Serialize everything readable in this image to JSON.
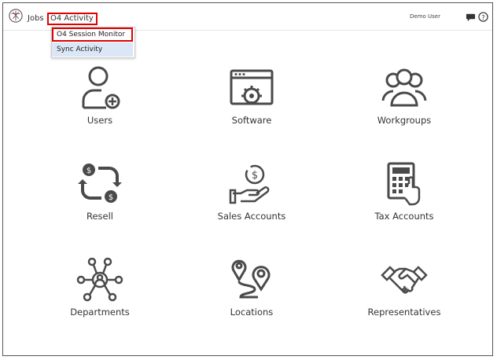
{
  "header": {
    "jobs_label": "Jobs",
    "activity_label": "O4 Activity",
    "user_label": "Demo User"
  },
  "dropdown": {
    "items": [
      {
        "label": "O4 Session Monitor"
      },
      {
        "label": "Sync Activity"
      }
    ]
  },
  "tiles": [
    {
      "label": "Users",
      "icon": "users-icon"
    },
    {
      "label": "Software",
      "icon": "software-icon"
    },
    {
      "label": "Workgroups",
      "icon": "workgroups-icon"
    },
    {
      "label": "Resell",
      "icon": "resell-icon"
    },
    {
      "label": "Sales Accounts",
      "icon": "sales-accounts-icon"
    },
    {
      "label": "Tax Accounts",
      "icon": "tax-accounts-icon"
    },
    {
      "label": "Departments",
      "icon": "departments-icon"
    },
    {
      "label": "Locations",
      "icon": "locations-icon"
    },
    {
      "label": "Representatives",
      "icon": "representatives-icon"
    }
  ],
  "colors": {
    "highlight_border": "#e00000",
    "icon": "#4a4a4a",
    "dropdown_hover": "#dbe7f6"
  }
}
